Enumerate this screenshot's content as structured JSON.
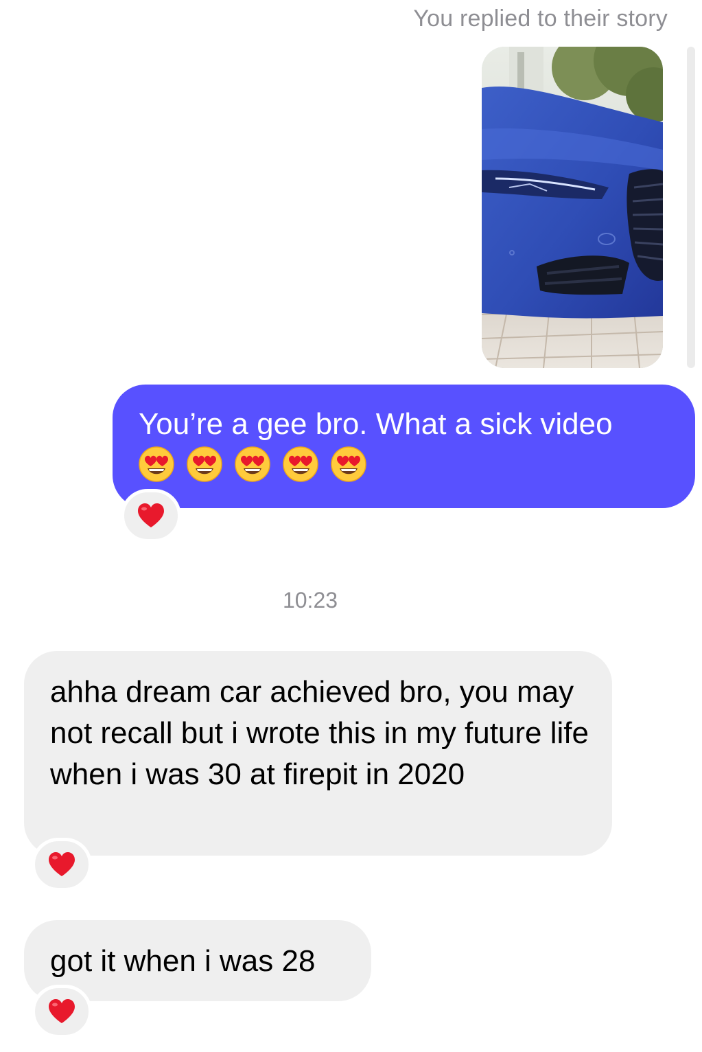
{
  "story_reply": {
    "label": "You replied to their story",
    "thumbnail_icon": "car-story-thumbnail"
  },
  "messages": [
    {
      "direction": "outgoing",
      "text": "You’re a gee bro. What a sick video",
      "emoji": [
        "😍",
        "😍",
        "😍",
        "😍",
        "😍"
      ],
      "reaction": "❤️",
      "bubble_color": "#5851ff"
    },
    {
      "direction": "incoming",
      "text": "ahha dream car achieved bro, you may not recall but i wrote this in my future life when i was 30 at firepit in 2020",
      "reaction": "❤️"
    },
    {
      "direction": "incoming",
      "text": "got it when i was 28",
      "reaction": "❤️"
    }
  ],
  "timestamp": "10:23",
  "colors": {
    "outgoing_bubble": "#5851ff",
    "incoming_bubble": "#efefef",
    "meta_text": "#8e8e93",
    "heart": "#e8192c"
  }
}
